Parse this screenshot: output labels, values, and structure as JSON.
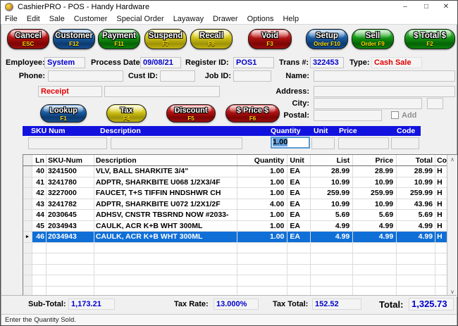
{
  "window": {
    "title": "CashierPRO - POS - Handy Hardware",
    "controls": {
      "minimize": "–",
      "maximize": "□",
      "close": "✕"
    }
  },
  "menu": [
    "File",
    "Edit",
    "Sale",
    "Customer",
    "Special Order",
    "Layaway",
    "Drawer",
    "Options",
    "Help"
  ],
  "toolbar_top": [
    {
      "label": "Cancel",
      "sub": "ESC",
      "color": "red"
    },
    {
      "label": "Customer",
      "sub": "F12",
      "color": "blue"
    },
    {
      "label": "Payment",
      "sub": "F11",
      "color": "green"
    },
    {
      "label": "Suspend",
      "sub": "F7",
      "color": "yellow"
    },
    {
      "label": "Recall",
      "sub": "F8",
      "color": "yellow"
    },
    {
      "label": "Void",
      "sub": "F3",
      "color": "red"
    },
    {
      "label": "Setup",
      "sub": "Order F10",
      "color": "blue"
    },
    {
      "label": "Sell",
      "sub": "Order  F9",
      "color": "green"
    },
    {
      "label": "$ Total $",
      "sub": "F2",
      "color": "green"
    }
  ],
  "header_fields": {
    "employee_label": "Employee:",
    "employee": "System",
    "process_date_label": "Process Date:",
    "process_date": "09/08/21",
    "register_label": "Register ID:",
    "register": "POS1",
    "trans_label": "Trans #:",
    "trans": "322453",
    "type_label": "Type:",
    "type": "Cash Sale"
  },
  "customer_fields": {
    "phone_label": "Phone:",
    "cust_id_label": "Cust ID:",
    "job_id_label": "Job ID:",
    "name_label": "Name:",
    "receipt_value": "Receipt",
    "address_label": "Address:",
    "city_label": "City:",
    "postal_label": "Postal:",
    "add_label": "Add"
  },
  "toolbar_mid": [
    {
      "label": "Lookup",
      "sub": "F1",
      "color": "blue"
    },
    {
      "label": "Tax",
      "sub": "F4",
      "color": "yellow"
    },
    {
      "label": "Discount",
      "sub": "F5",
      "color": "red"
    },
    {
      "label": "$ Price $",
      "sub": "F6",
      "color": "red"
    }
  ],
  "entry_bar": {
    "sku_label": "SKU Num",
    "description_label": "Description",
    "quantity_label": "Quantity",
    "unit_label": "Unit",
    "price_label": "Price",
    "code_label": "Code",
    "quantity_value": "1.00"
  },
  "grid": {
    "headers": {
      "ln": "Ln",
      "sku": "SKU-Num",
      "desc": "Description",
      "qty": "Quantity",
      "unit": "Unit",
      "list": "List",
      "price": "Price",
      "total": "Total",
      "code": "Code"
    },
    "selector_arrow": "►",
    "scrollbar": {
      "up": "∧",
      "down": "∨"
    },
    "rows": [
      {
        "ln": "40",
        "sku": "3241500",
        "desc": "VLV, BALL SHARKITE 3/4\"",
        "qty": "1.00",
        "unit": "EA",
        "list": "28.99",
        "price": "28.99",
        "total": "28.99",
        "code": "H",
        "selected": false
      },
      {
        "ln": "41",
        "sku": "3241780",
        "desc": "ADPTR, SHARKBITE U068 1/2X3/4F",
        "qty": "1.00",
        "unit": "EA",
        "list": "10.99",
        "price": "10.99",
        "total": "10.99",
        "code": "H",
        "selected": false
      },
      {
        "ln": "42",
        "sku": "3227000",
        "desc": "FAUCET, T+S TIFFIN HNDSHWR CH",
        "qty": "1.00",
        "unit": "EA",
        "list": "259.99",
        "price": "259.99",
        "total": "259.99",
        "code": "H",
        "selected": false
      },
      {
        "ln": "43",
        "sku": "3241782",
        "desc": "ADPTR, SHARKBITE U072 1/2X1/2F",
        "qty": "4.00",
        "unit": "EA",
        "list": "10.99",
        "price": "10.99",
        "total": "43.96",
        "code": "H",
        "selected": false
      },
      {
        "ln": "44",
        "sku": "2030645",
        "desc": "ADHSV, CNSTR TBSRND NOW #2033-",
        "qty": "1.00",
        "unit": "EA",
        "list": "5.69",
        "price": "5.69",
        "total": "5.69",
        "code": "H",
        "selected": false
      },
      {
        "ln": "45",
        "sku": "2034943",
        "desc": "CAULK, ACR K+B WHT 300ML",
        "qty": "1.00",
        "unit": "EA",
        "list": "4.99",
        "price": "4.99",
        "total": "4.99",
        "code": "H",
        "selected": false
      },
      {
        "ln": "46",
        "sku": "2034943",
        "desc": "CAULK, ACR K+B WHT 300ML",
        "qty": "1.00",
        "unit": "EA",
        "list": "4.99",
        "price": "4.99",
        "total": "4.99",
        "code": "H",
        "selected": true
      }
    ]
  },
  "totals": {
    "subtotal_label": "Sub-Total:",
    "subtotal": "1,173.21",
    "tax_rate_label": "Tax Rate:",
    "tax_rate": "13.000%",
    "tax_total_label": "Tax Total:",
    "tax_total": "152.52",
    "total_label": "Total:",
    "total": "1,325.73"
  },
  "status_bar": "Enter the Quantity Sold.",
  "colors": {
    "header_bar_blue": "#1212df",
    "selected_row_blue": "#0f6fd7",
    "value_text_blue": "#0000cd",
    "alert_red": "#e30000",
    "button_red": "#9c1010",
    "button_blue": "#155090",
    "button_green": "#0e830e",
    "button_yellow": "#c0b214"
  }
}
